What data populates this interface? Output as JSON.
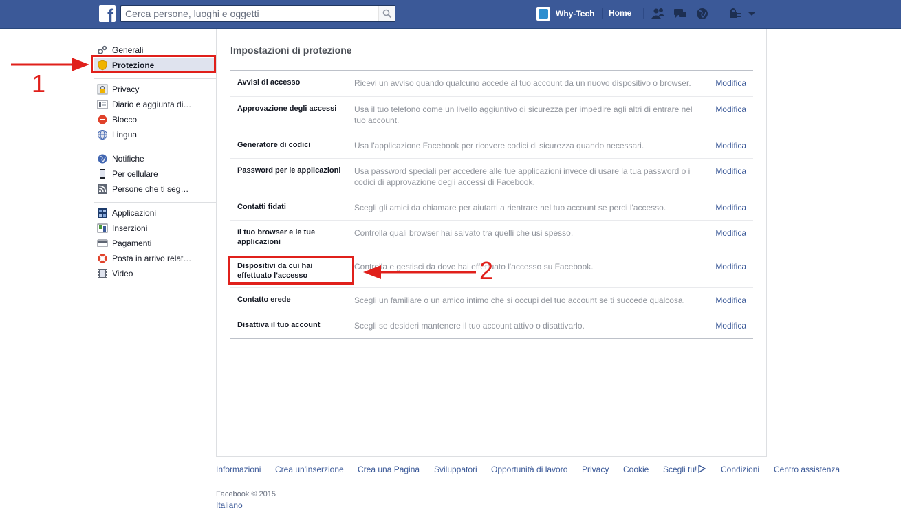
{
  "topbar": {
    "search_placeholder": "Cerca persone, luoghi e oggetti",
    "profile_name": "Why-Tech",
    "home_label": "Home"
  },
  "sidebar": {
    "groups": [
      [
        {
          "label": "Generali",
          "icon": "gears-icon"
        },
        {
          "label": "Protezione",
          "icon": "shield-icon",
          "active": true
        }
      ],
      [
        {
          "label": "Privacy",
          "icon": "lock-icon"
        },
        {
          "label": "Diario e aggiunta di…",
          "icon": "timeline-icon"
        },
        {
          "label": "Blocco",
          "icon": "block-icon"
        },
        {
          "label": "Lingua",
          "icon": "globe-icon"
        }
      ],
      [
        {
          "label": "Notifiche",
          "icon": "notifications-globe-icon"
        },
        {
          "label": "Per cellulare",
          "icon": "mobile-icon"
        },
        {
          "label": "Persone che ti seg…",
          "icon": "rss-icon"
        }
      ],
      [
        {
          "label": "Applicazioni",
          "icon": "apps-icon"
        },
        {
          "label": "Inserzioni",
          "icon": "ads-icon"
        },
        {
          "label": "Pagamenti",
          "icon": "credit-card-icon"
        },
        {
          "label": "Posta in arrivo relat…",
          "icon": "lifebuoy-icon"
        },
        {
          "label": "Video",
          "icon": "film-icon"
        }
      ]
    ]
  },
  "main": {
    "title": "Impostazioni di protezione",
    "edit_label": "Modifica",
    "rows": [
      {
        "label": "Avvisi di accesso",
        "desc": "Ricevi un avviso quando qualcuno accede al tuo account da un nuovo dispositivo o browser."
      },
      {
        "label": "Approvazione degli accessi",
        "desc": "Usa il tuo telefono come un livello aggiuntivo di sicurezza per impedire agli altri di entrare nel tuo account."
      },
      {
        "label": "Generatore di codici",
        "desc": "Usa l'applicazione Facebook per ricevere codici di sicurezza quando necessari."
      },
      {
        "label": "Password per le applicazioni",
        "desc": "Usa password speciali per accedere alle tue applicazioni invece di usare la tua password o i codici di approvazione degli accessi di Facebook."
      },
      {
        "label": "Contatti fidati",
        "desc": "Scegli gli amici da chiamare per aiutarti a rientrare nel tuo account se perdi l'accesso."
      },
      {
        "label": "Il tuo browser e le tue applicazioni",
        "desc": "Controlla quali browser hai salvato tra quelli che usi spesso."
      },
      {
        "label": "Dispositivi da cui hai effettuato l'accesso",
        "desc": "Controlla e gestisci da dove hai effettuato l'accesso su Facebook."
      },
      {
        "label": "Contatto erede",
        "desc": "Scegli un familiare o un amico intimo che si occupi del tuo account se ti succede qualcosa."
      },
      {
        "label": "Disattiva il tuo account",
        "desc": "Scegli se desideri mantenere il tuo account attivo o disattivarlo."
      }
    ]
  },
  "footer": {
    "links": [
      "Informazioni",
      "Crea un'inserzione",
      "Crea una Pagina",
      "Sviluppatori",
      "Opportunità di lavoro",
      "Privacy",
      "Cookie",
      "Scegli tu!",
      "Condizioni",
      "Centro assistenza"
    ],
    "copyright": "Facebook © 2015",
    "language": "Italiano"
  },
  "annotations": {
    "marker_1": "1",
    "marker_2": "2",
    "color": "#e0201b"
  },
  "colors": {
    "brand_blue": "#3b5998",
    "link": "#3b5998",
    "muted_text": "#90949c"
  }
}
